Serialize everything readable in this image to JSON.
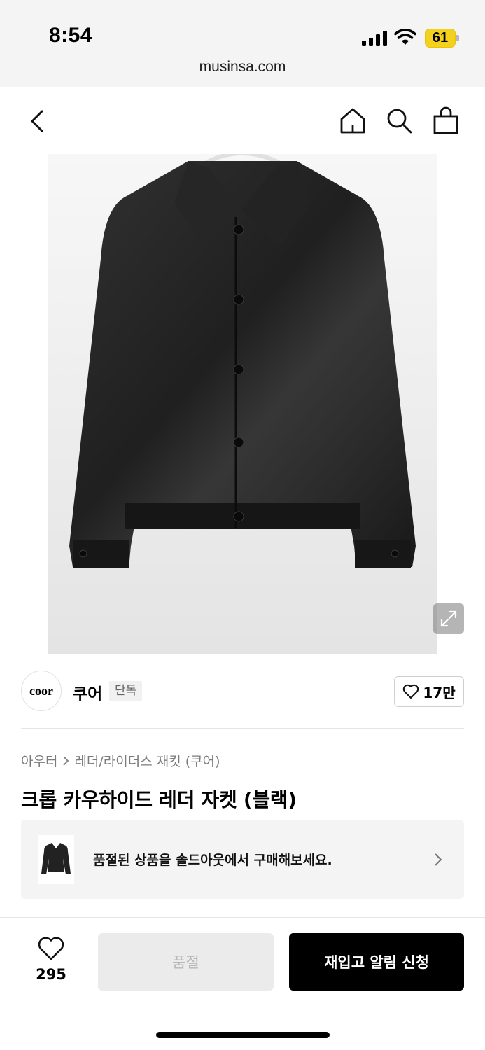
{
  "status_bar": {
    "time": "8:54",
    "battery": "61",
    "battery_color": "#f5d11f",
    "icons": [
      "signal-icon",
      "wifi-icon",
      "battery-icon"
    ]
  },
  "browser": {
    "url": "musinsa.com"
  },
  "nav": {
    "icons": [
      "back-icon",
      "home-icon",
      "search-icon",
      "shopping-bag-icon"
    ]
  },
  "product": {
    "image_alt": "black leather jacket",
    "expand_icon": "expand-icon",
    "brand": {
      "logo_text": "coor",
      "name": "쿠어",
      "badge": "단독"
    },
    "likes": "17만",
    "breadcrumb": {
      "category": "아우터",
      "separator_icon": "chevron-right-icon",
      "subcategory": "레더/라이더스 재킷 (쿠어)"
    },
    "title": "크롭 카우하이드 레더 자켓 (블랙)"
  },
  "soldout_banner": {
    "text": "품절된 상품을 솔드아웃에서 구매해보세요."
  },
  "bottom_bar": {
    "wish_count": "295",
    "soldout_label": "품절",
    "restock_label": "재입고 알림 신청",
    "accent_color": "#000000"
  }
}
